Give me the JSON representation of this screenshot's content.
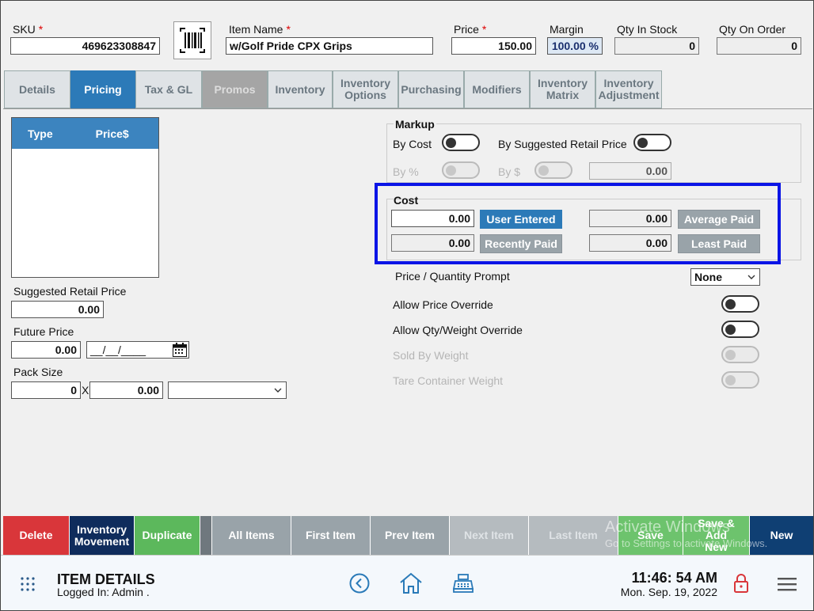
{
  "header": {
    "sku": {
      "label": "SKU",
      "value": "469623308847"
    },
    "item_name": {
      "label": "Item Name",
      "value": "w/Golf Pride CPX Grips"
    },
    "price": {
      "label": "Price",
      "value": "150.00"
    },
    "margin": {
      "label": "Margin",
      "value": "100.00 %"
    },
    "qty_in_stock": {
      "label": "Qty In Stock",
      "value": "0"
    },
    "qty_on_order": {
      "label": "Qty On Order",
      "value": "0"
    },
    "required_mark": "*"
  },
  "tabs": [
    {
      "label": "Details",
      "state": "normal"
    },
    {
      "label": "Pricing",
      "state": "active"
    },
    {
      "label": "Tax & GL",
      "state": "normal"
    },
    {
      "label": "Promos",
      "state": "disabled"
    },
    {
      "label": "Inventory",
      "state": "normal"
    },
    {
      "label": "Inventory Options",
      "state": "normal"
    },
    {
      "label": "Purchasing",
      "state": "normal"
    },
    {
      "label": "Modifiers",
      "state": "normal"
    },
    {
      "label": "Inventory Matrix",
      "state": "normal"
    },
    {
      "label": "Inventory Adjustment",
      "state": "normal"
    }
  ],
  "price_table": {
    "columns": [
      "Type",
      "Price$"
    ]
  },
  "suggested_retail": {
    "label": "Suggested Retail Price",
    "value": "0.00"
  },
  "future_price": {
    "label": "Future Price",
    "value": "0.00",
    "date_placeholder": "__/__/____"
  },
  "pack_size": {
    "label": "Pack Size",
    "qty": "0",
    "x": "X",
    "amount": "0.00",
    "unit": ""
  },
  "markup": {
    "title": "Markup",
    "by_cost": "By Cost",
    "by_suggested_retail": "By Suggested Retail Price",
    "by_percent": "By %",
    "by_dollar": "By $",
    "value": "0.00"
  },
  "cost": {
    "title": "Cost",
    "user_entered_value": "0.00",
    "user_entered_label": "User Entered",
    "average_paid_value": "0.00",
    "average_paid_label": "Average Paid",
    "recently_paid_value": "0.00",
    "recently_paid_label": "Recently Paid",
    "least_paid_value": "0.00",
    "least_paid_label": "Least Paid"
  },
  "options": {
    "price_qty_prompt": {
      "label": "Price / Quantity Prompt",
      "value": "None"
    },
    "allow_price_override": "Allow Price Override",
    "allow_qty_override": "Allow Qty/Weight Override",
    "sold_by_weight": "Sold By Weight",
    "tare_container_weight": "Tare Container Weight"
  },
  "actions": [
    {
      "label": "Delete",
      "color": "#d9363a"
    },
    {
      "label": "Inventory Movement",
      "color": "#0f2c5c"
    },
    {
      "label": "Duplicate",
      "color": "#5cb85c"
    },
    {
      "label": "All Items",
      "color": "#99a3a9"
    },
    {
      "label": "First Item",
      "color": "#99a3a9"
    },
    {
      "label": "Prev Item",
      "color": "#99a3a9"
    },
    {
      "label": "Next Item",
      "color": "#b5bbbf"
    },
    {
      "label": "Last Item",
      "color": "#b5bbbf"
    },
    {
      "label": "Save",
      "color": "#6dc36d"
    },
    {
      "label": "Save & Add New",
      "color": "#6dc36d"
    },
    {
      "label": "New",
      "color": "#0f3f73"
    }
  ],
  "watermark": {
    "line1": "Activate Windows",
    "line2": "Go to Settings to activate Windows."
  },
  "footer": {
    "title": "ITEM DETAILS",
    "logged_in": "Logged In:  Admin .",
    "time": "11:46: 54 AM",
    "date": "Mon. Sep. 19, 2022"
  },
  "colors": {
    "accent": "#2c7ab8",
    "highlight_box": "#0a14e6"
  }
}
